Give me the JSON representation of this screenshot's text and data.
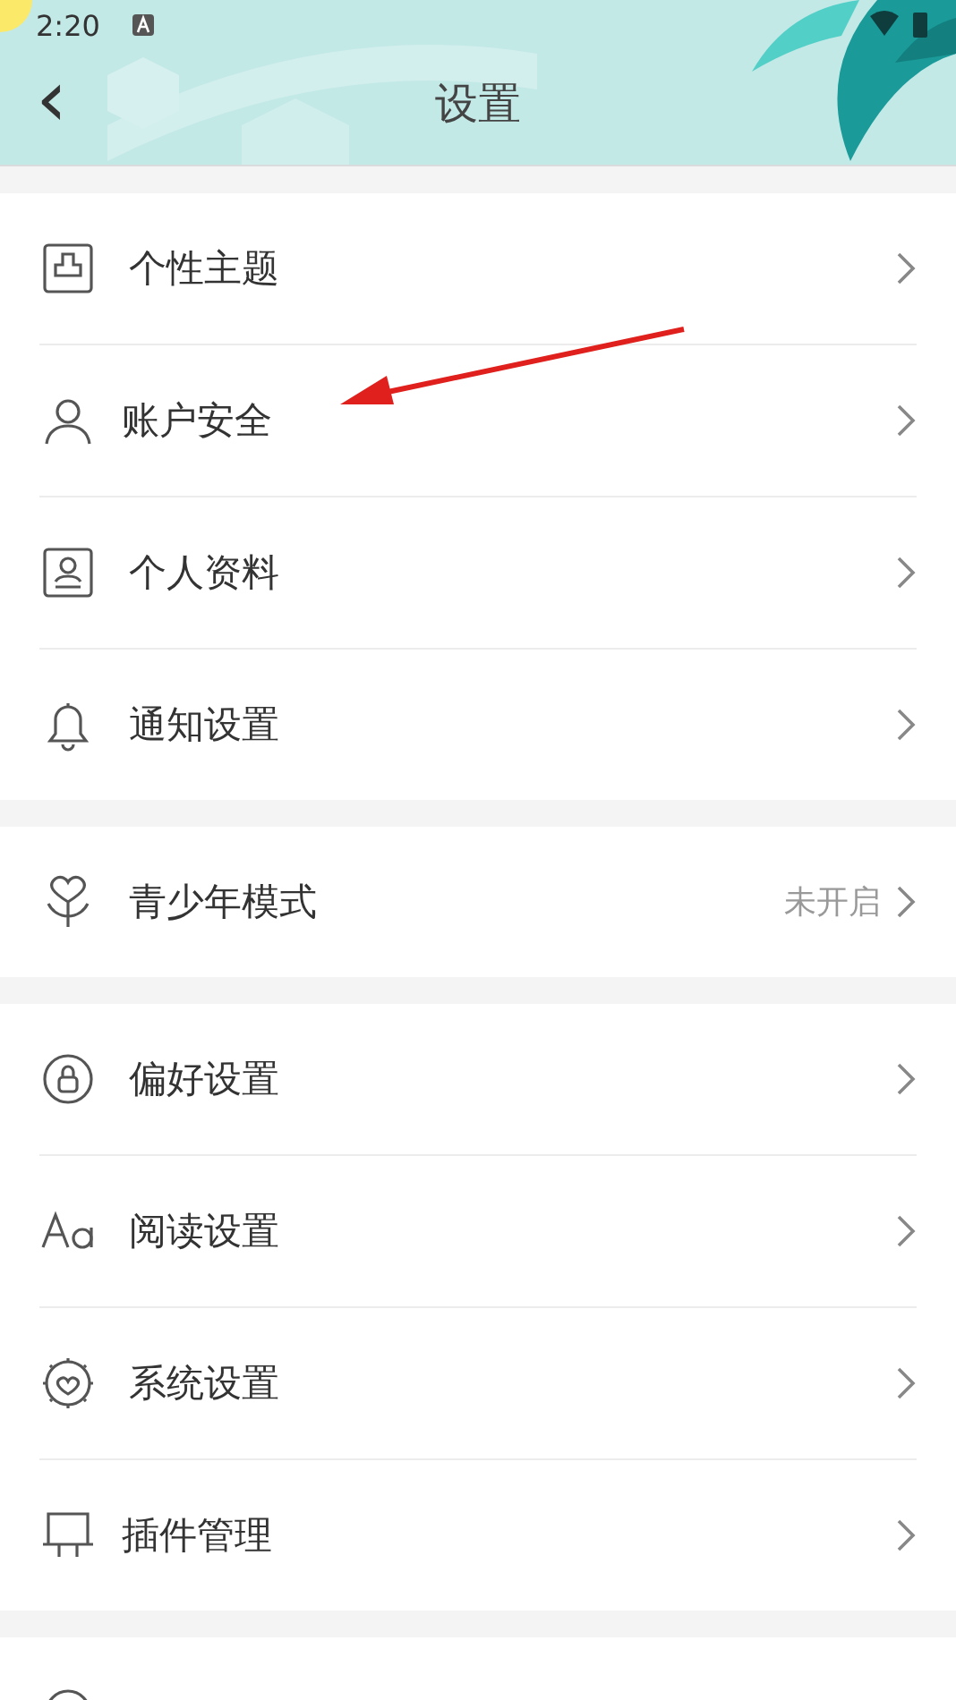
{
  "status_bar": {
    "time": "2:20"
  },
  "header": {
    "back": "‹",
    "title": "设置"
  },
  "groups": [
    {
      "items": [
        {
          "label": "个性主题"
        },
        {
          "label": "账户安全"
        },
        {
          "label": "个人资料"
        },
        {
          "label": "通知设置"
        }
      ]
    },
    {
      "items": [
        {
          "label": "青少年模式",
          "value": "未开启"
        }
      ]
    },
    {
      "items": [
        {
          "label": "偏好设置"
        },
        {
          "label": "阅读设置"
        },
        {
          "label": "系统设置"
        },
        {
          "label": "插件管理"
        }
      ]
    }
  ]
}
